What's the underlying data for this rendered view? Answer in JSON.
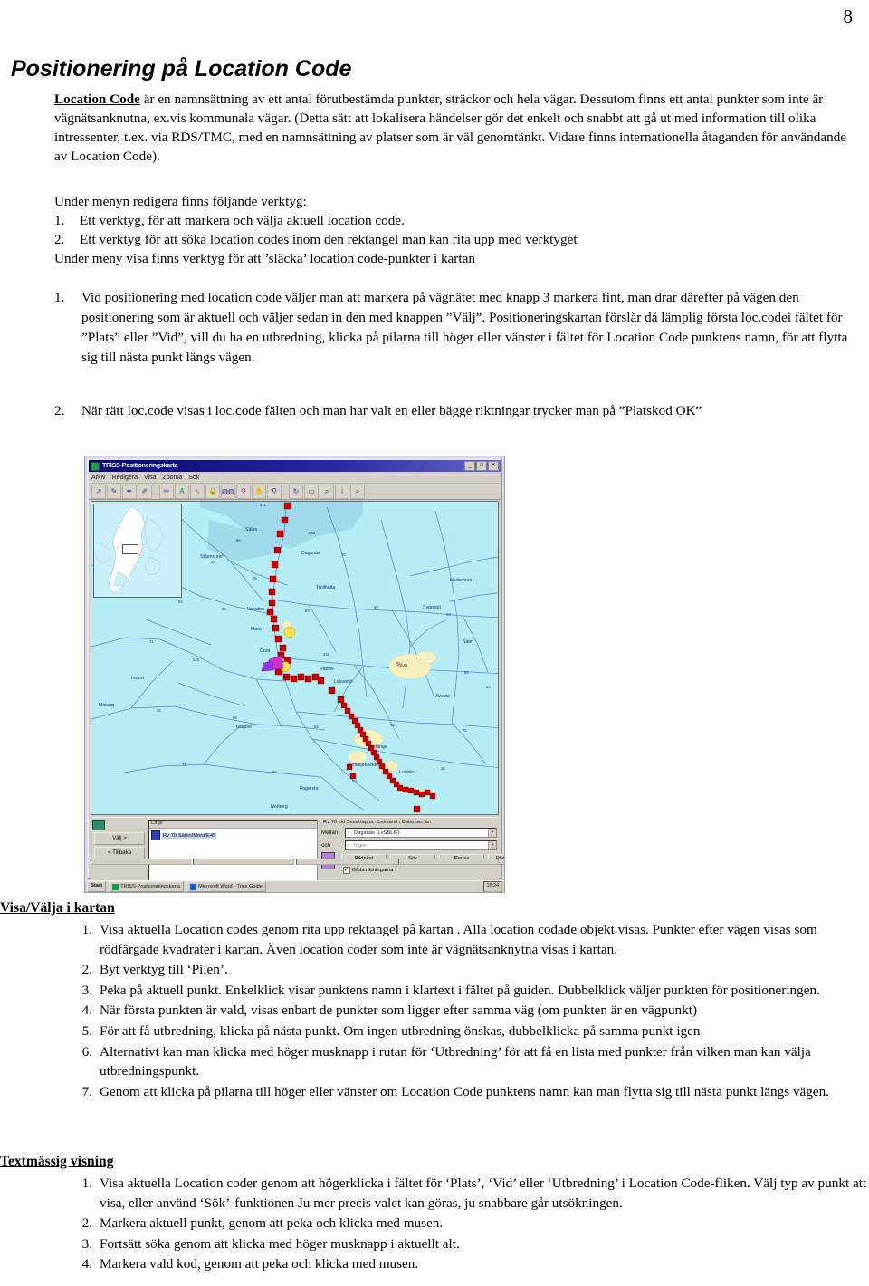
{
  "page": {
    "number": "8"
  },
  "title": "Positionering på Location Code",
  "intro": {
    "lead": "Location Code",
    "text": " är en namnsättning av ett antal förutbestämda punkter, sträckor och hela vägar. Dessutom finns ett antal punkter som inte är vägnätsanknutna, ex.vis kommunala vägar. (Detta sätt att lokalisera händelser gör det enkelt och snabbt att gå ut med information till olika intressenter, t.ex. via RDS/TMC, med en namnsättning av platser som är väl genomtänkt. Vidare finns internationella åtaganden för användande av Location Code)."
  },
  "tools": {
    "heading": "Under menyn redigera finns följande verktyg:",
    "items": [
      {
        "num": "1.",
        "pre": "Ett verktyg, för att markera och ",
        "underlined": "välja",
        "post": " aktuell location code."
      },
      {
        "num": "2.",
        "pre": "Ett verktyg för att ",
        "underlined": "söka",
        "post": " location codes inom den rektangel man kan rita upp med verktyget"
      }
    ],
    "footer_pre": "Under meny visa finns verktyg för att ",
    "footer_underlined": "’släcka’",
    "footer_post": " location code-punkter i kartan"
  },
  "steps": [
    {
      "num": "1.",
      "text": "Vid positionering med location code väljer man att markera på vägnätet med knapp 3 markera fint, man drar därefter på  vägen den positionering som är aktuell och väljer sedan in den med knappen ”Välj”. Positioneringskartan förslår då lämplig första loc.codei fältet för ”Plats” eller ”Vid”, vill du ha en utbredning, klicka på pilarna till höger eller vänster i fältet för Location Code punktens namn, för att flytta sig till nästa punkt längs vägen."
    },
    {
      "num": "2.",
      "text": "När rätt loc.code visas i loc.code fälten och man har valt en eller bägge riktningar trycker man på ”Platskod OK”"
    }
  ],
  "screenshot": {
    "window_title": "TRISS-Positioneringskarta",
    "window_buttons": [
      "_",
      "□",
      "✕"
    ],
    "menu": [
      "Arkiv",
      "Redigera",
      "Visa",
      "Zooma",
      "Sök"
    ],
    "toolbar_icons": [
      "pointer-arrow-icon",
      "select-node-icon",
      "select-link-icon",
      "select-area-icon",
      "pen-icon",
      "label-icon",
      "marker-icon",
      "lock-icon",
      "binoculars-icon",
      "pin-icon",
      "hand-icon",
      "magnifier-icon",
      "pan-rotate-icon",
      "rectangle-zoom-icon",
      "zoom-in-icon",
      "info-icon",
      "find-icon"
    ],
    "panel": {
      "left_buttons": [
        "Välj >",
        "< Tillbaka"
      ],
      "list_header": "Läge",
      "list_items": [
        {
          "label": "Rv 70 Sälen/Mora/E45"
        }
      ],
      "right_header": "Rv 70 vid Sveatrappa : Leksand i Dalarnas län",
      "fields": [
        {
          "label": "Mellan",
          "value": "Dagsnäs (LvSBLIF)"
        },
        {
          "label": "och",
          "value": "Ingen"
        }
      ],
      "buttons": [
        "Riktning",
        "Sök",
        "Rensa",
        "Platskod OK"
      ],
      "checkbox": {
        "label": "Båda riktningarna",
        "checked": true
      }
    },
    "taskbar": {
      "start": "Start",
      "tasks": [
        "TRISS-Positioneringskarta",
        "Microsoft Word - Triss Guide"
      ],
      "tray": "15:24"
    },
    "map": {
      "labels": [
        "Stjärnsund",
        "Vansbro",
        "Mora",
        "Orsa",
        "Dagsnäs",
        "Sälen",
        "Falun",
        "Borlänge",
        "Ludvika",
        "Hedemora",
        "Avesta",
        "Säter",
        "Malung",
        "Rättvik",
        "Leksand",
        "Smedjebacken",
        "Fagersta",
        "Norberg",
        "Gagnef",
        "Insjön",
        "Svärdsjö"
      ],
      "road_numbers": [
        "70",
        "80",
        "50",
        "66",
        "26",
        "45",
        "69",
        "64",
        "71",
        "68",
        "243",
        "311",
        "293",
        "245"
      ],
      "marker_colors": {
        "selected": "#cc0000",
        "highlight": "#ffe44d",
        "road": "#3344bb",
        "water": "#9fd9ea",
        "land": "#b4eef4"
      }
    }
  },
  "section_visa": {
    "heading": "Visa/Välja i kartan",
    "items": [
      {
        "num": "1.",
        "text": "Visa aktuella Location codes genom rita upp rektangel på kartan . Alla location codade objekt visas.  Punkter efter vägen visas som rödfärgade kvadrater i kartan. Även location coder som inte är vägnätsanknytna visas i kartan."
      },
      {
        "num": "2.",
        "text": "Byt verktyg till ‘Pilen’."
      },
      {
        "num": "3.",
        "text": "Peka på aktuell punkt. Enkelklick visar punktens namn i klartext i fältet på guiden. Dubbelklick väljer punkten för positioneringen."
      },
      {
        "num": "4.",
        "text": "När första punkten är vald,     visas enbart de punkter som ligger efter samma väg (om  punkten är en vägpunkt)"
      },
      {
        "num": "5.",
        "text": "För att få utbredning, klicka på nästa punkt. Om ingen utbredning önskas, dubbelklicka på samma punkt igen."
      },
      {
        "num": "6.",
        "text": "Alternativt  kan man klicka med höger musknapp i rutan för ‘Utbredning’ för att få en lista med punkter från vilken man kan välja utbredningspunkt."
      },
      {
        "num": "7.",
        "text": "Genom att klicka på pilarna till höger eller vänster om Location Code punktens namn kan man flytta sig till nästa punkt längs vägen."
      }
    ]
  },
  "section_text": {
    "heading": "Textmässig  visning",
    "items": [
      {
        "num": "1.",
        "text": "Visa aktuella Location coder genom att högerklicka i fältet för ‘Plats’, ‘Vid’ eller ‘Utbredning’ i Location Code-fliken. Välj typ av punkt att visa, eller använd ‘Sök’-funktionen Ju mer precis valet kan göras, ju snabbare går utsökningen."
      },
      {
        "num": "2.",
        "text": "Markera aktuell punkt, genom att peka och klicka med musen."
      },
      {
        "num": "3.",
        "text": "Fortsätt söka genom att klicka med höger musknapp i aktuellt alt."
      },
      {
        "num": "4.",
        "text": "Markera vald kod, genom att peka och klicka med musen."
      }
    ]
  }
}
